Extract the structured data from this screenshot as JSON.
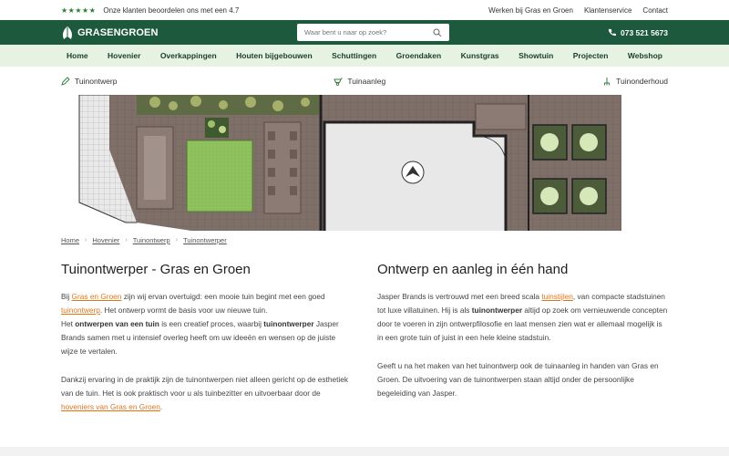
{
  "topbar": {
    "rating_text": "Onze klanten beoordelen ons met een 4.7",
    "stars": "★★★★★",
    "links": [
      "Werken bij Gras en Groen",
      "Klantenservice",
      "Contact"
    ]
  },
  "header": {
    "logo_text": "GRASENGROEN",
    "search_placeholder": "Waar bent u naar op zoek?",
    "phone": "073 521 5673"
  },
  "nav": {
    "items": [
      "Home",
      "Hovenier",
      "Overkappingen",
      "Houten bijgebouwen",
      "Schuttingen",
      "Groendaken",
      "Kunstgras",
      "Showtuin",
      "Projecten",
      "Webshop"
    ]
  },
  "subnav": {
    "items": [
      "Tuinontwerp",
      "Tuinaanleg",
      "Tuinonderhoud"
    ]
  },
  "breadcrumb": [
    "Home",
    "Hovenier",
    "Tuinontwerp",
    "Tuinontwerper"
  ],
  "left": {
    "title": "Tuinontwerper - Gras en Groen",
    "p1_a": "Bij ",
    "p1_link1": "Gras en Groen",
    "p1_b": " zijn wij ervan overtuigd: een mooie tuin begint met een goed ",
    "p1_link2": "tuinontwerp",
    "p1_c": ". Het ontwerp vormt de basis voor uw nieuwe tuin.",
    "p2_a": "Het ",
    "p2_bold1": "ontwerpen van een tuin",
    "p2_b": " is een creatief proces, waarbij ",
    "p2_bold2": "tuinontwerper",
    "p2_c": " Jasper Brands samen met u intensief overleg heeft om uw ideeën en wensen op de juiste wijze te vertalen.",
    "p3_a": "Dankzij ervaring in de praktijk zijn de tuinontwerpen niet alleen gericht op de esthetiek van de tuin. Het is ook praktisch voor u als tuinbezitter en uitvoerbaar door de ",
    "p3_link": "hoveniers van Gras en Groen",
    "p3_b": "."
  },
  "right": {
    "title": "Ontwerp en aanleg in één hand",
    "p1_a": "Jasper Brands is vertrouwd met een breed scala ",
    "p1_link": "tuinstijlen",
    "p1_b": ", van compacte stadstuinen tot luxe villatuinen. Hij is als ",
    "p1_bold": "tuinontwerper",
    "p1_c": " altijd op zoek om vernieuwende concepten door te voeren in zijn ontwerpfilosofie en laat mensen zien wat er allemaal mogelijk is in een grote tuin of juist in een hele kleine stadstuin.",
    "p2": "Geeft u na het maken van het tuinontwerp ook de tuinaanleg in handen van Gras en Groen. De uitvoering van de tuinontwerpen staan altijd onder de persoonlijke begeleiding van Jasper."
  },
  "colors": {
    "brand_green": "#1d5a3d",
    "nav_bg": "#e6f3e3",
    "link_orange": "#e0761a"
  }
}
